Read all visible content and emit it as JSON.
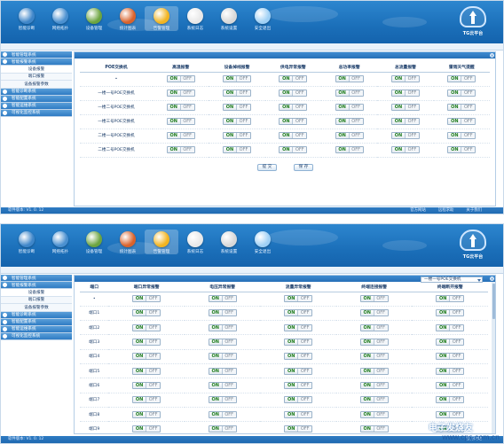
{
  "toolbar": [
    {
      "label": "智能诊断",
      "icon": "globe-icon",
      "color": "#3f86c9"
    },
    {
      "label": "网络拓扑",
      "icon": "globe-network-icon",
      "color": "#4a90d0"
    },
    {
      "label": "设备管理",
      "icon": "device-icon",
      "color": "#6ca43f"
    },
    {
      "label": "统计图表",
      "icon": "chart-icon",
      "color": "#d9622b"
    },
    {
      "label": "告警管理",
      "icon": "alarm-pie-icon",
      "color": "#f2b420"
    },
    {
      "label": "系统日志",
      "icon": "log-icon",
      "color": "#e8e8e8"
    },
    {
      "label": "系统设置",
      "icon": "wrench-icon",
      "color": "#d8d8d8"
    },
    {
      "label": "安全退出",
      "icon": "power-icon",
      "color": "#9fd0f5"
    }
  ],
  "brand": {
    "label": "TG云平台"
  },
  "sidebar": {
    "groups_top": [
      "智能管理系统",
      "智能报警系统"
    ],
    "items": [
      "设备报警",
      "端口报警",
      "设备报警参数"
    ],
    "groups_bottom": [
      "智能诊断系统",
      "智能配置系统",
      "智能运维系统",
      "可视化监控系统"
    ]
  },
  "panel1": {
    "headers": [
      "POE交换机",
      "高温报警",
      "设备掉线报警",
      "供电异常报警",
      "总功率报警",
      "总流量报警",
      "雷雨天气提醒"
    ],
    "rows": [
      "•",
      "一楼一号POE交换机",
      "一楼二号POE交换机",
      "一楼三号POE交换机",
      "二楼一号POE交换机",
      "二楼二号POE交换机"
    ],
    "on_label": "ON",
    "off_label": "OFF",
    "buttons": [
      "提 交",
      "保 存"
    ]
  },
  "panel2": {
    "select_value": "一楼一号POE交换机",
    "headers": [
      "端口",
      "端口异常报警",
      "电压异常报警",
      "流量异常报警",
      "终端连接报警",
      "终端断开报警"
    ],
    "rows": [
      "•",
      "端口1",
      "端口2",
      "端口3",
      "端口4",
      "端口5",
      "端口6",
      "端口7",
      "端口8",
      "端口9"
    ]
  },
  "status": {
    "version": "软件版本: V1. 0. 12",
    "links": [
      "官方网站",
      "远程求助",
      "关于我们"
    ]
  },
  "watermark": {
    "logo": "电子发烧友",
    "url": "www.cps.com.cn"
  }
}
